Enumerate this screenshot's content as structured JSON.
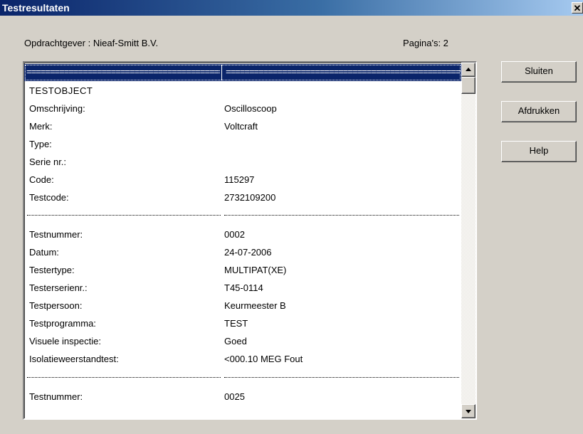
{
  "window": {
    "title": "Testresultaten",
    "close_glyph": "✕"
  },
  "header": {
    "client": "Opdrachtgever : Nieaf-Smitt B.V.",
    "pages": "Pagina's: 2"
  },
  "list": {
    "selected_row": {
      "c1": "================================================",
      "c2": "=========================================================="
    },
    "rows": [
      {
        "c1": "TESTOBJECT",
        "c2": ""
      },
      {
        "c1": "Omschrijving:",
        "c2": "Oscilloscoop"
      },
      {
        "c1": "Merk:",
        "c2": "Voltcraft"
      },
      {
        "c1": "Type:",
        "c2": ""
      },
      {
        "c1": "Serie nr.:",
        "c2": ""
      },
      {
        "c1": "Code:",
        "c2": "115297"
      },
      {
        "c1": "Testcode:",
        "c2": "2732109200"
      },
      {
        "c1": "Testnummer:",
        "c2": "0002"
      },
      {
        "c1": "Datum:",
        "c2": "24-07-2006"
      },
      {
        "c1": "Testertype:",
        "c2": "MULTIPAT(XE)"
      },
      {
        "c1": "Testerserienr.:",
        "c2": "T45-0114"
      },
      {
        "c1": "Testpersoon:",
        "c2": "Keurmeester B"
      },
      {
        "c1": "Testprogramma:",
        "c2": "TEST"
      },
      {
        "c1": "Visuele inspectie:",
        "c2": "Goed"
      },
      {
        "c1": "Isolatieweerstandtest:",
        "c2": "<000.10 MEG Fout"
      },
      {
        "c1": "Testnummer:",
        "c2": "0025"
      }
    ],
    "scroll_position": 0
  },
  "buttons": {
    "close": "Sluiten",
    "print": "Afdrukken",
    "help": "Help"
  },
  "colors": {
    "selection": "#0a246a",
    "face": "#d4d0c8",
    "titlebar_start": "#0a246a",
    "titlebar_end": "#a6caf0"
  }
}
